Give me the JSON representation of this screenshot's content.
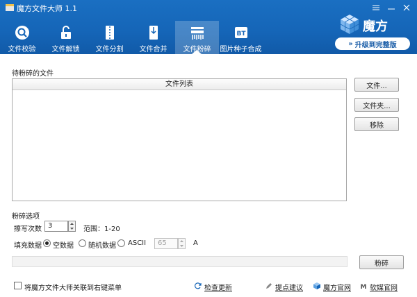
{
  "app": {
    "title": "魔方文件大师 1.1"
  },
  "toolbar": [
    {
      "label": "文件校验",
      "icon": "magnifier-icon"
    },
    {
      "label": "文件解锁",
      "icon": "unlock-icon"
    },
    {
      "label": "文件分割",
      "icon": "split-file-icon"
    },
    {
      "label": "文件合并",
      "icon": "merge-file-icon"
    },
    {
      "label": "文件粉碎",
      "icon": "shredder-icon",
      "active": true
    },
    {
      "label": "图片种子合成",
      "icon": "bt-icon"
    }
  ],
  "brand": {
    "name": "魔方",
    "upgrade": "升级到完整版"
  },
  "files": {
    "section": "待粉碎的文件",
    "column": "文件列表"
  },
  "buttons": {
    "file": "文件...",
    "folder": "文件夹...",
    "remove": "移除",
    "shred": "粉碎"
  },
  "options": {
    "section": "粉碎选项",
    "passes_label": "擦写次数",
    "passes_value": "3",
    "range": "范围：1-20",
    "fill_label": "填充数据",
    "radios": [
      "空数据",
      "随机数据",
      "ASCII"
    ],
    "ascii_value": "65",
    "ascii_char": "A"
  },
  "footer": {
    "context_menu": "将魔方文件大师关联到右键菜单",
    "check_update": "检查更新",
    "suggest": "提点建议",
    "website": "魔方官网",
    "ruanmei": "软媒官网"
  },
  "colors": {
    "header": "#1565b7",
    "accent": "#1b5ea8"
  }
}
